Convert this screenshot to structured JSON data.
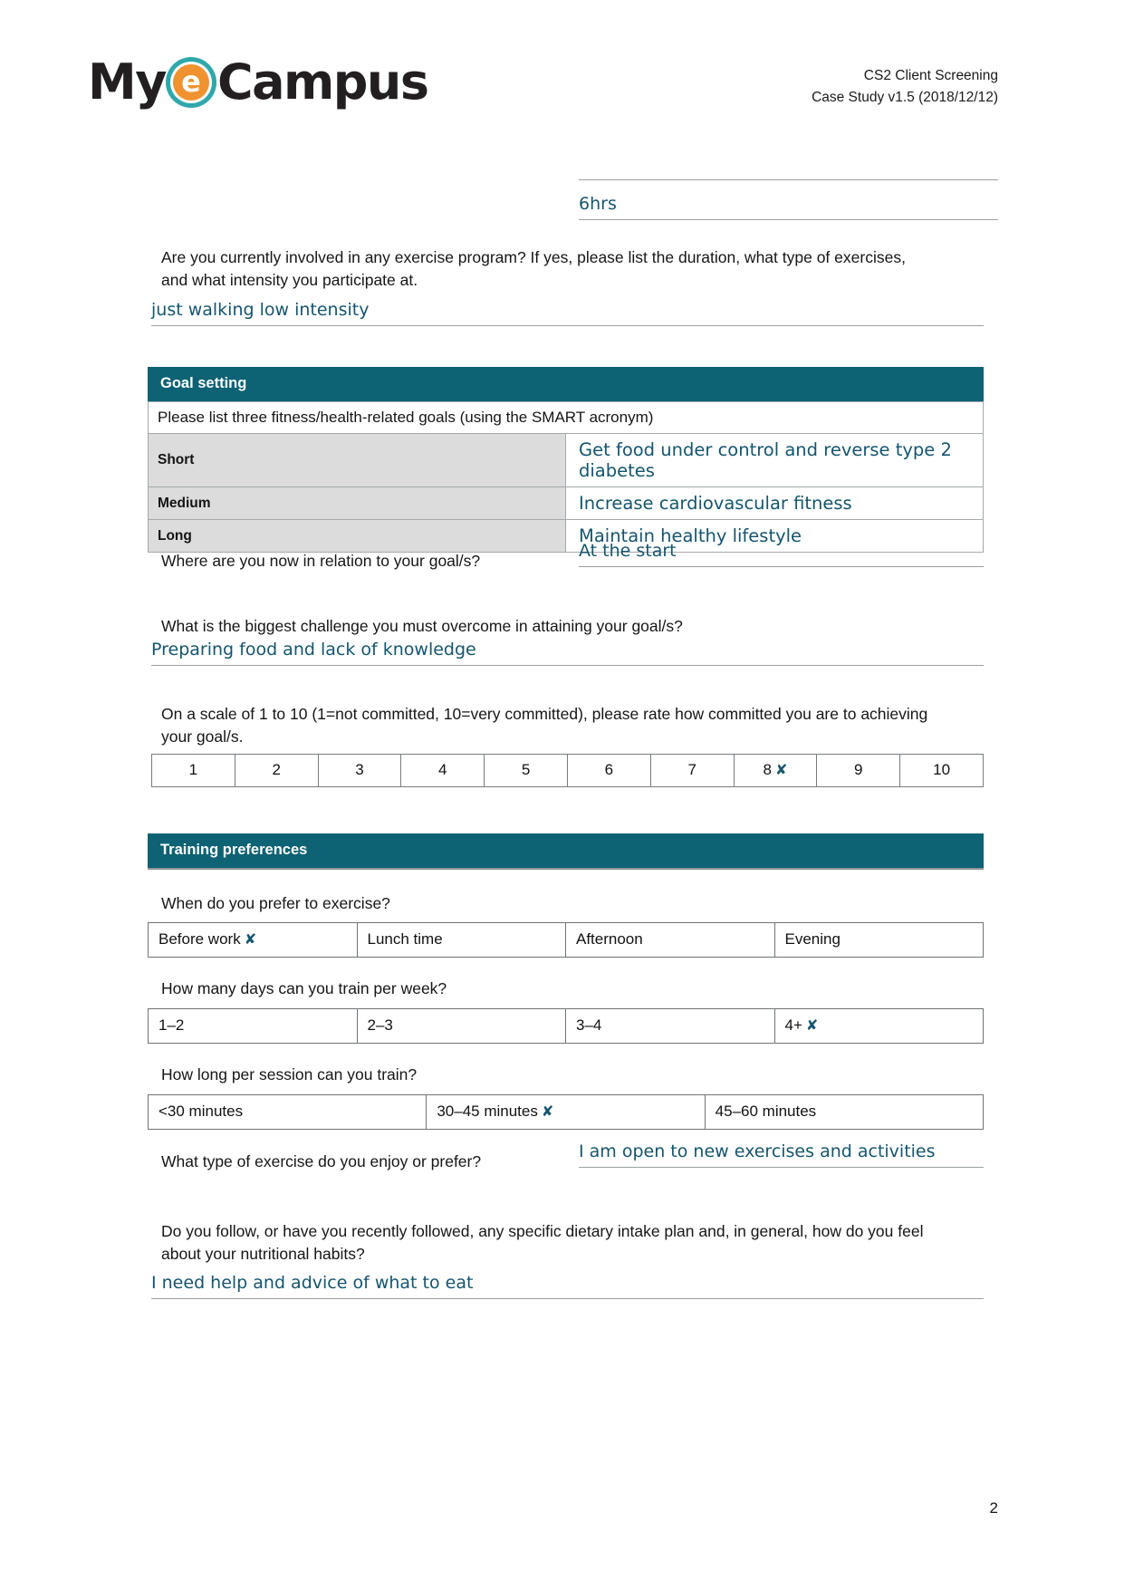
{
  "header": {
    "logo": {
      "part1": "My",
      "badge": "e",
      "part2": "Campus"
    },
    "doc_title": "CS2 Client Screening",
    "doc_version": "Case Study v1.5 (2018/12/12)"
  },
  "top_answer": {
    "value": "6hrs"
  },
  "exercise_program": {
    "question": "Are you currently involved in any exercise program? If yes, please list the duration, what type of exercises, and what intensity you participate at.",
    "answer": "just walking low intensity"
  },
  "goal_setting": {
    "section_title": "Goal setting",
    "prompt": "Please list three fitness/health-related goals (using the SMART acronym)",
    "goals": [
      {
        "term": "Short",
        "value": "Get food under control and reverse type 2 diabetes"
      },
      {
        "term": "Medium",
        "value": "Increase cardiovascular fitness"
      },
      {
        "term": "Long",
        "value": "Maintain healthy lifestyle"
      }
    ],
    "position_question": "Where are you now in relation to your goal/s?",
    "position_answer": "At the start",
    "challenge_question": "What is the biggest challenge you must overcome in attaining your goal/s?",
    "challenge_answer": "Preparing food and lack of knowledge",
    "commitment_question": "On a scale of 1 to 10 (1=not committed, 10=very committed), please rate how committed you are to achieving your goal/s.",
    "commitment_scale": [
      "1",
      "2",
      "3",
      "4",
      "5",
      "6",
      "7",
      "8",
      "9",
      "10"
    ],
    "commitment_selected": "8",
    "mark_glyph": "✘"
  },
  "training_preferences": {
    "section_title": "Training preferences",
    "when_question": "When do you prefer to exercise?",
    "when_options": [
      "Before work",
      "Lunch time",
      "Afternoon",
      "Evening"
    ],
    "when_selected": "Before work",
    "days_question": "How many days can you train per week?",
    "days_options": [
      "1–2",
      "2–3",
      "3–4",
      "4+"
    ],
    "days_selected": "4+",
    "session_question": "How long per session can you train?",
    "session_options": [
      "<30 minutes",
      "30–45 minutes",
      "45–60 minutes"
    ],
    "session_selected": "30–45 minutes",
    "type_question": "What type of exercise do you enjoy or prefer?",
    "type_answer": "I am open to new exercises and activities",
    "diet_question": "Do you follow, or have you recently followed, any specific dietary intake plan and, in general, how do you feel about your nutritional habits?",
    "diet_answer": "I need help and advice of what to eat"
  },
  "footer": {
    "page_number": "2"
  },
  "colors": {
    "section_bar": "#0d6273",
    "answer_text": "#15556e",
    "label_cell": "#dcdcdc",
    "logo_ring": "#2fa8ab",
    "logo_inner": "#f0922f"
  }
}
